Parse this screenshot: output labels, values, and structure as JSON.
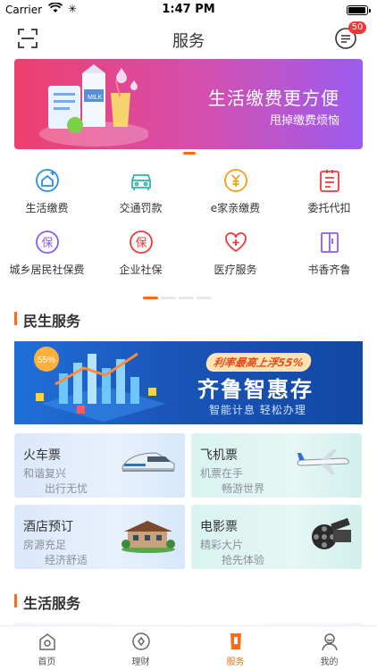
{
  "status_bar": {
    "carrier": "Carrier",
    "time": "1:47 PM"
  },
  "nav": {
    "title": "服务",
    "badge": "50"
  },
  "banner": {
    "title": "生活缴费更方便",
    "subtitle": "甩掉缴费烦恼"
  },
  "grid_items": [
    {
      "label": "生活缴费",
      "icon": "home-plus-icon",
      "color": "#2b8de6"
    },
    {
      "label": "交通罚款",
      "icon": "car-icon",
      "color": "#2bb8a6"
    },
    {
      "label": "e家亲缴费",
      "icon": "yuan-coin-icon",
      "color": "#f0a21a"
    },
    {
      "label": "委托代扣",
      "icon": "document-icon",
      "color": "#f0383b"
    },
    {
      "label": "城乡居民社保费",
      "icon": "insurance-badge-icon",
      "color": "#8a5cf0"
    },
    {
      "label": "企业社保",
      "icon": "insurance-badge-icon",
      "color": "#f0383b"
    },
    {
      "label": "医疗服务",
      "icon": "heart-plus-icon",
      "color": "#f0383b"
    },
    {
      "label": "书香齐鲁",
      "icon": "book-icon",
      "color": "#8a5cf0"
    }
  ],
  "sections": {
    "minsheng": "民生服务",
    "shenghuo": "生活服务"
  },
  "promo": {
    "tag": "利率最高上浮55%",
    "title": "齐鲁智惠存",
    "subtitle": "智能计息  轻松办理",
    "coin": "55%"
  },
  "cards": [
    {
      "title": "火车票",
      "line1": "和谐复兴",
      "line2": "出行无忧",
      "icon": "train-icon"
    },
    {
      "title": "飞机票",
      "line1": "机票在手",
      "line2": "畅游世界",
      "icon": "airplane-icon"
    },
    {
      "title": "酒店预订",
      "line1": "房源充足",
      "line2": "经济舒适",
      "icon": "hotel-icon"
    },
    {
      "title": "电影票",
      "line1": "精彩大片",
      "line2": "抢先体验",
      "icon": "film-reel-icon"
    }
  ],
  "tabs": [
    {
      "label": "首页",
      "icon": "home-icon"
    },
    {
      "label": "理财",
      "icon": "finance-icon"
    },
    {
      "label": "服务",
      "icon": "service-icon",
      "active": true
    },
    {
      "label": "我的",
      "icon": "profile-icon"
    }
  ],
  "colors": {
    "accent": "#ff6a1a",
    "badge": "#f0383b"
  }
}
